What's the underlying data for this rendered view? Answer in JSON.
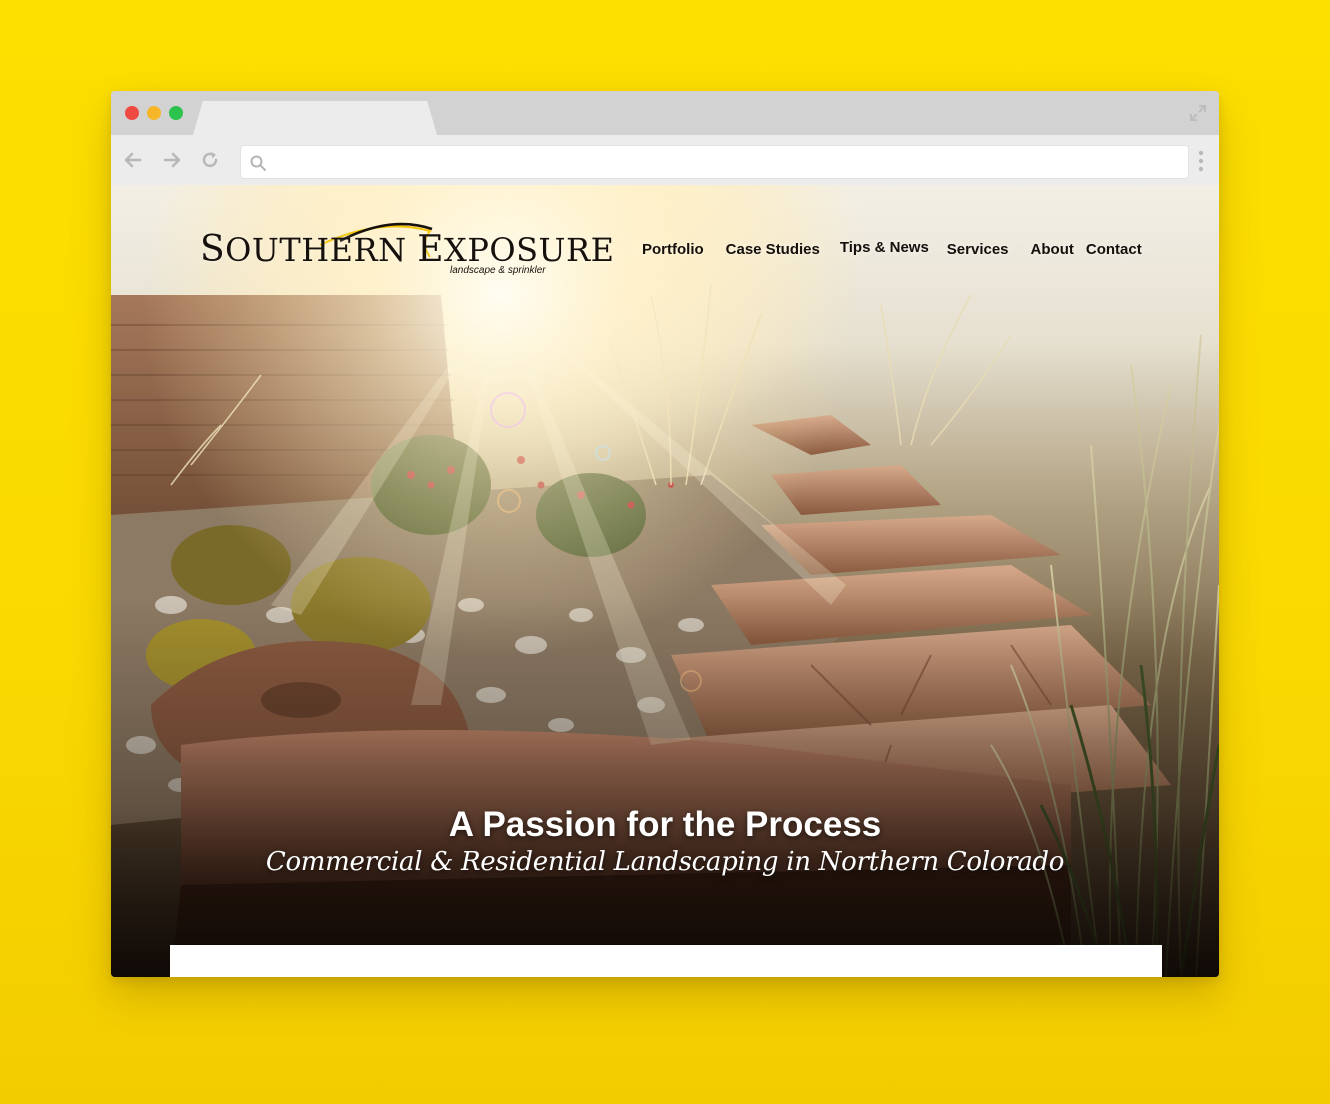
{
  "browser": {
    "address_value": "",
    "address_placeholder": ""
  },
  "site": {
    "logo": {
      "name_part1_cap": "S",
      "name_part1_rest": "OUTHERN ",
      "name_part2_cap": "E",
      "name_part2_rest": "XPOSURE",
      "tagline": "landscape & sprinkler"
    },
    "nav": {
      "portfolio": "Portfolio",
      "case_studies": "Case Studies",
      "tips_news": "Tips & News",
      "services": "Services",
      "about": "About",
      "contact": "Contact"
    },
    "hero": {
      "title": "A Passion for the Process",
      "subtitle": "Commercial & Residential Landscaping in Northern Colorado"
    }
  },
  "colors": {
    "background": "#fde000",
    "logo_accent": "#f4c300",
    "nav_text": "#15100b"
  }
}
